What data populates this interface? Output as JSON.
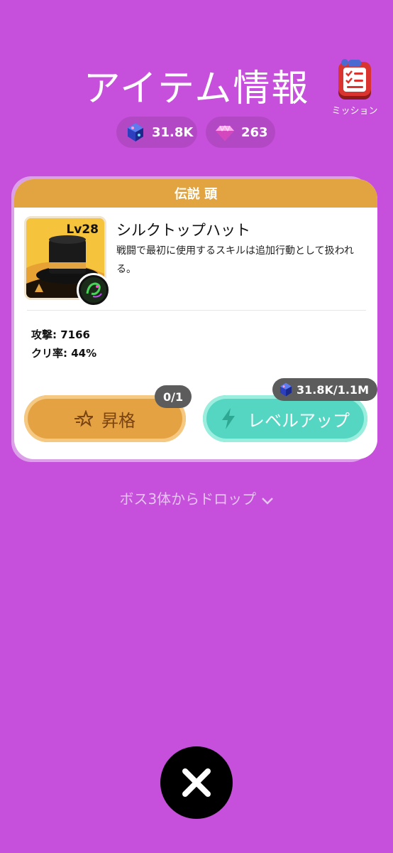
{
  "header": {
    "title": "アイテム情報",
    "mission_label": "ミッション",
    "mission_icon": "clipboard-checklist-icon"
  },
  "currency": {
    "crystal_icon": "blue-crystal-icon",
    "crystal_amount": "31.8K",
    "gem_icon": "pink-diamond-icon",
    "gem_amount": "263"
  },
  "item": {
    "rarity_slot": "伝説 頭",
    "level": "Lv28",
    "name": "シルクトップハット",
    "description": "戦闘で最初に使用するスキルは追加行動として扱われる。",
    "stats": [
      {
        "label": "攻撃: 7166"
      },
      {
        "label": "クリ率: 44%"
      }
    ],
    "colors": {
      "header": "#e2a440",
      "image_bg": "#f5c33c"
    }
  },
  "actions": {
    "promote_label": "昇格",
    "promote_count": "0/1",
    "promote_icon": "sparkle-star-icon",
    "level_up_label": "レベルアップ",
    "level_up_cost": "31.8K/1.1M",
    "level_up_icon": "lightning-bolt-icon"
  },
  "drop_info": "ボス3体からドロップ",
  "close_icon": "close-x-icon",
  "colors": {
    "background": "#c64fdb",
    "promote": "#e4a243",
    "level_up": "#55d6c2"
  }
}
